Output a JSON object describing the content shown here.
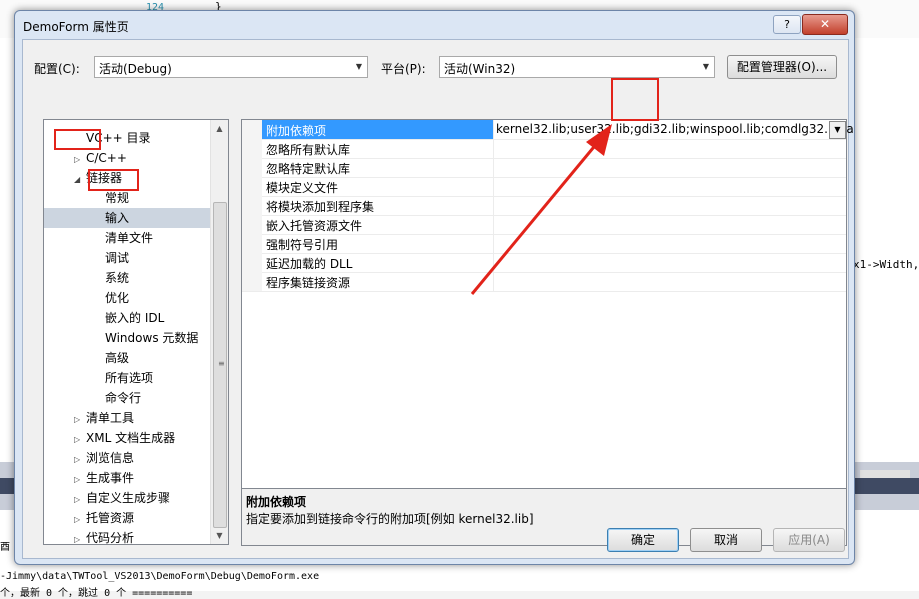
{
  "background": {
    "line_number": "124",
    "brace": "}",
    "code_right": "x1->Width,",
    "output_line1": "-Jimmy\\data\\TWTool_VS2013\\DemoForm\\Debug\\DemoForm.exe",
    "output_line2": "个，最新 0 个，跳过 0 个 ==========",
    "side_char": "酉"
  },
  "dialog": {
    "title": "DemoForm 属性页",
    "help": "?",
    "close": "✕"
  },
  "config": {
    "config_label": "配置(C):",
    "config_value": "活动(Debug)",
    "platform_label": "平台(P):",
    "platform_value": "活动(Win32)",
    "manager_button": "配置管理器(O)..."
  },
  "tree": {
    "items": [
      {
        "label": "VC++ 目录",
        "level": 1,
        "expander": ""
      },
      {
        "label": "C/C++",
        "level": 1,
        "expander": "▷"
      },
      {
        "label": "链接器",
        "level": 1,
        "expander": "◢"
      },
      {
        "label": "常规",
        "level": 2,
        "expander": ""
      },
      {
        "label": "输入",
        "level": 2,
        "expander": ""
      },
      {
        "label": "清单文件",
        "level": 2,
        "expander": ""
      },
      {
        "label": "调试",
        "level": 2,
        "expander": ""
      },
      {
        "label": "系统",
        "level": 2,
        "expander": ""
      },
      {
        "label": "优化",
        "level": 2,
        "expander": ""
      },
      {
        "label": "嵌入的 IDL",
        "level": 2,
        "expander": ""
      },
      {
        "label": "Windows 元数据",
        "level": 2,
        "expander": ""
      },
      {
        "label": "高级",
        "level": 2,
        "expander": ""
      },
      {
        "label": "所有选项",
        "level": 2,
        "expander": ""
      },
      {
        "label": "命令行",
        "level": 2,
        "expander": ""
      },
      {
        "label": "清单工具",
        "level": 1,
        "expander": "▷"
      },
      {
        "label": "XML 文档生成器",
        "level": 1,
        "expander": "▷"
      },
      {
        "label": "浏览信息",
        "level": 1,
        "expander": "▷"
      },
      {
        "label": "生成事件",
        "level": 1,
        "expander": "▷"
      },
      {
        "label": "自定义生成步骤",
        "level": 1,
        "expander": "▷"
      },
      {
        "label": "托管资源",
        "level": 1,
        "expander": "▷"
      },
      {
        "label": "代码分析",
        "level": 1,
        "expander": "▷"
      }
    ],
    "selected": "输入"
  },
  "grid": {
    "rows": [
      {
        "name": "附加依赖项",
        "value": "kernel32.lib;user32.lib;gdi32.lib;winspool.lib;comdlg32.lib;a"
      },
      {
        "name": "忽略所有默认库",
        "value": ""
      },
      {
        "name": "忽略特定默认库",
        "value": ""
      },
      {
        "name": "模块定义文件",
        "value": ""
      },
      {
        "name": "将模块添加到程序集",
        "value": ""
      },
      {
        "name": "嵌入托管资源文件",
        "value": ""
      },
      {
        "name": "强制符号引用",
        "value": ""
      },
      {
        "name": "延迟加载的 DLL",
        "value": ""
      },
      {
        "name": "程序集链接资源",
        "value": ""
      }
    ],
    "dropdown_glyph": "▼"
  },
  "description": {
    "heading": "附加依赖项",
    "text": "指定要添加到链接命令行的附加项[例如 kernel32.lib]"
  },
  "buttons": {
    "ok": "确定",
    "cancel": "取消",
    "apply": "应用(A)"
  },
  "colors": {
    "annotation": "#e2231a",
    "selection": "#3399ff"
  }
}
